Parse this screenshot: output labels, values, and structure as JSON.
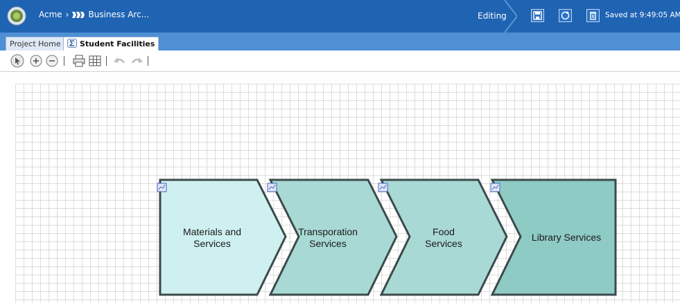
{
  "header": {
    "breadcrumb_root": "Acme",
    "breadcrumb_sep": "›",
    "breadcrumb_current": "Business Arc...",
    "mode": "Editing",
    "saved_status": "Saved at 9:49:05 AM"
  },
  "tabs": [
    {
      "label": "Project Home",
      "active": false
    },
    {
      "label": "Student Facilities",
      "active": true
    }
  ],
  "toolbar": {
    "buttons": [
      "select-icon",
      "zoom-in-icon",
      "zoom-out-icon",
      "print-icon",
      "grid-icon",
      "undo-icon",
      "redo-icon"
    ]
  },
  "diagram": {
    "shapes": [
      {
        "line1": "Materials and",
        "line2": "Services",
        "fill": "#cff0f0"
      },
      {
        "line1": "Transporation",
        "line2": "Services",
        "fill": "#a8d9d5"
      },
      {
        "line1": "Food",
        "line2": "Services",
        "fill": "#a8d9d5"
      },
      {
        "line1": "Library Services",
        "line2": "",
        "fill": "#8ecbc4"
      }
    ],
    "stroke": "#3b4a4a"
  },
  "colors": {
    "header": "#1f63b3",
    "tabstrip": "#4f8fd4"
  }
}
